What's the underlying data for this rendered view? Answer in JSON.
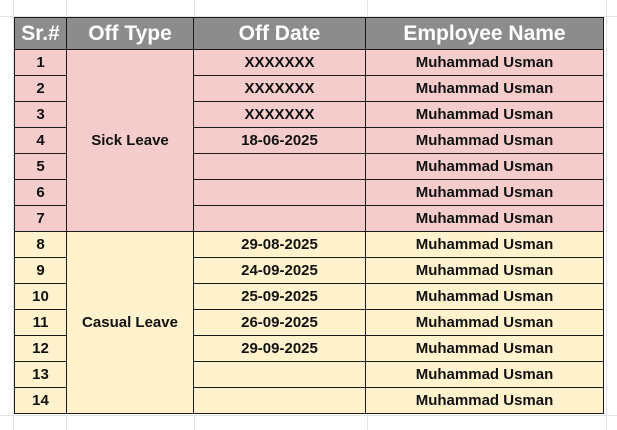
{
  "table": {
    "headers": [
      "Sr.#",
      "Off Type",
      "Off Date",
      "Employee Name"
    ],
    "groups": [
      {
        "off_type": "Sick Leave",
        "color": "#f4cccc"
      },
      {
        "off_type": "Casual Leave",
        "color": "#fff2cc"
      }
    ],
    "rows": [
      {
        "sr": "1",
        "date": "XXXXXXX",
        "name": "Muhammad Usman"
      },
      {
        "sr": "2",
        "date": "XXXXXXX",
        "name": "Muhammad Usman"
      },
      {
        "sr": "3",
        "date": "XXXXXXX",
        "name": "Muhammad Usman"
      },
      {
        "sr": "4",
        "date": "18-06-2025",
        "name": "Muhammad Usman"
      },
      {
        "sr": "5",
        "date": "",
        "name": "Muhammad Usman"
      },
      {
        "sr": "6",
        "date": "",
        "name": "Muhammad Usman"
      },
      {
        "sr": "7",
        "date": "",
        "name": "Muhammad Usman"
      },
      {
        "sr": "8",
        "date": "29-08-2025",
        "name": "Muhammad Usman"
      },
      {
        "sr": "9",
        "date": "24-09-2025",
        "name": "Muhammad Usman"
      },
      {
        "sr": "10",
        "date": "25-09-2025",
        "name": "Muhammad Usman"
      },
      {
        "sr": "11",
        "date": "26-09-2025",
        "name": "Muhammad Usman"
      },
      {
        "sr": "12",
        "date": "29-09-2025",
        "name": "Muhammad Usman"
      },
      {
        "sr": "13",
        "date": "",
        "name": "Muhammad Usman"
      },
      {
        "sr": "14",
        "date": "",
        "name": "Muhammad Usman"
      }
    ]
  },
  "colors": {
    "header_bg": "#8c8c8c",
    "header_text": "#ffffff",
    "gridline": "#e2e3e3"
  }
}
